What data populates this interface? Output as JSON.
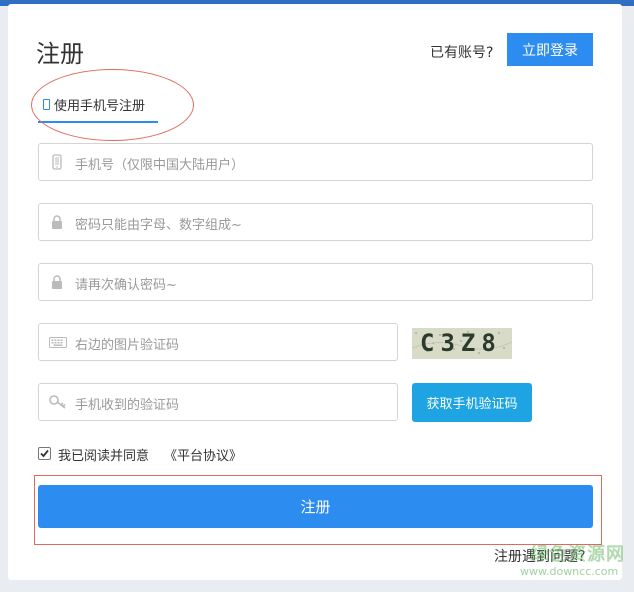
{
  "header": {
    "title": "注册",
    "have_account": "已有账号?",
    "login_label": "立即登录"
  },
  "tab": {
    "label": "使用手机号注册"
  },
  "fields": {
    "phone_placeholder": "手机号（仅限中国大陆用户）",
    "password_placeholder": "密码只能由字母、数字组成~",
    "password_confirm_placeholder": "请再次确认密码~",
    "captcha_placeholder": "右边的图片验证码",
    "sms_code_placeholder": "手机收到的验证码"
  },
  "captcha": {
    "text": "C3Z8"
  },
  "sms_button": "获取手机验证码",
  "agreement": {
    "checked": true,
    "text": "我已阅读并同意",
    "link": "《平台协议》"
  },
  "submit_label": "注册",
  "help_link": "注册遇到问题？",
  "watermark": {
    "cn": "绿色资源网",
    "url": "www.downcc.com"
  },
  "colors": {
    "primary": "#2d8cf0",
    "sms_button": "#1ea3e3",
    "annotation": "#e06a5e",
    "top_bar": "#2f6fc2"
  }
}
